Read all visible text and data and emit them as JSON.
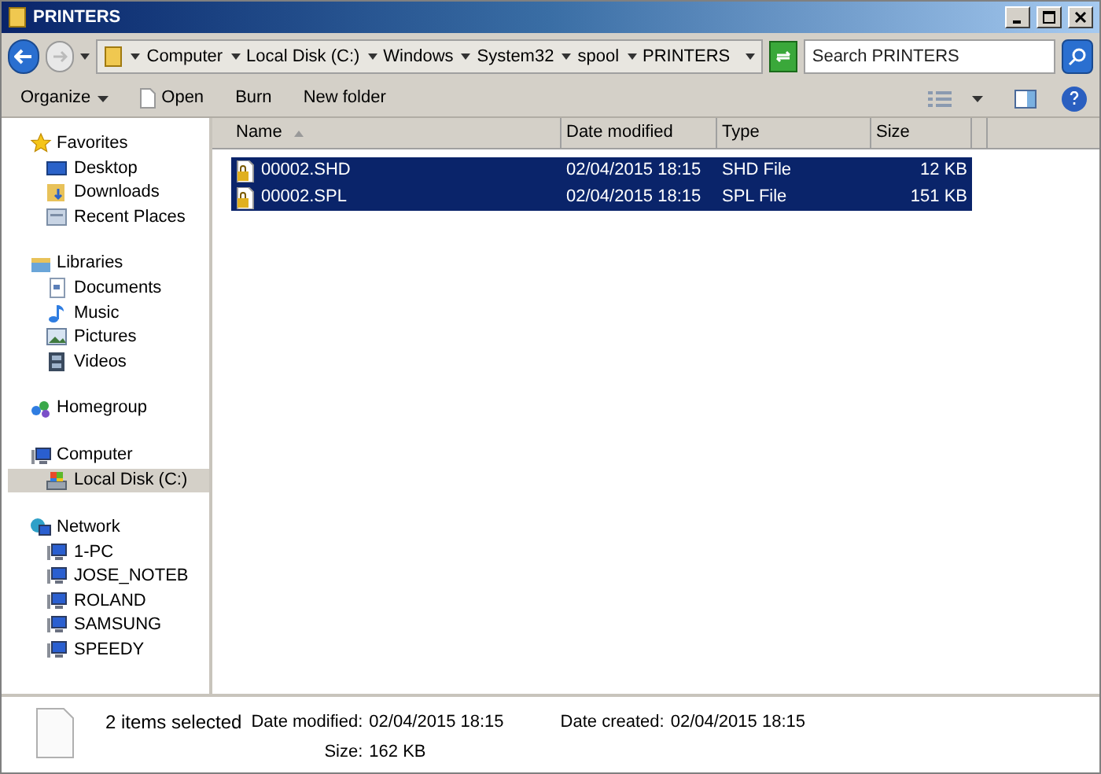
{
  "window": {
    "title": "PRINTERS"
  },
  "address": {
    "crumbs": [
      "Computer",
      "Local Disk (C:)",
      "Windows",
      "System32",
      "spool",
      "PRINTERS"
    ]
  },
  "search": {
    "placeholder": "Search PRINTERS"
  },
  "toolbar": [
    {
      "label": "Organize",
      "kind": "menu"
    },
    {
      "label": "Open",
      "kind": "icon"
    },
    {
      "label": "Burn",
      "kind": "plain"
    },
    {
      "label": "New folder",
      "kind": "plain"
    }
  ],
  "sidebar": {
    "groups": [
      {
        "label": "Favorites",
        "kind": "star",
        "selected": false,
        "children": [
          {
            "label": "Desktop",
            "kind": "desktop",
            "selected": false
          },
          {
            "label": "Downloads",
            "kind": "downloads",
            "selected": false
          },
          {
            "label": "Recent Places",
            "kind": "recent",
            "selected": false
          }
        ]
      },
      {
        "label": "Libraries",
        "kind": "library",
        "selected": false,
        "children": [
          {
            "label": "Documents",
            "kind": "document",
            "selected": false
          },
          {
            "label": "Music",
            "kind": "music",
            "selected": false
          },
          {
            "label": "Pictures",
            "kind": "pictures",
            "selected": false
          },
          {
            "label": "Videos",
            "kind": "videos",
            "selected": false
          }
        ]
      },
      {
        "label": "Homegroup",
        "kind": "homegroup",
        "selected": false
      },
      {
        "label": "Computer",
        "kind": "computer",
        "selected": false,
        "children": [
          {
            "label": "Local Disk (C:)",
            "kind": "disk",
            "selected": true
          }
        ]
      },
      {
        "label": "Network",
        "kind": "network",
        "selected": false,
        "children": [
          {
            "label": "1-PC",
            "kind": "computer",
            "selected": false
          },
          {
            "label": "JOSE_NOTEB",
            "kind": "computer",
            "selected": false
          },
          {
            "label": "ROLAND",
            "kind": "computer",
            "selected": false
          },
          {
            "label": "SAMSUNG",
            "kind": "computer",
            "selected": false
          },
          {
            "label": "SPEEDY",
            "kind": "computer",
            "selected": false
          }
        ]
      }
    ]
  },
  "table": {
    "columns": [
      {
        "label": "Name",
        "sorted": true
      },
      {
        "label": "Date modified",
        "sorted": false
      },
      {
        "label": "Type",
        "sorted": false
      },
      {
        "label": "Size",
        "sorted": false
      }
    ],
    "rows": [
      {
        "name": "00002.SHD",
        "date": "02/04/2015 18:15",
        "type": "SHD File",
        "size": "12 KB",
        "selected": true
      },
      {
        "name": "00002.SPL",
        "date": "02/04/2015 18:15",
        "type": "SPL File",
        "size": "151 KB",
        "selected": true
      }
    ]
  },
  "details": {
    "summary": "2 items selected",
    "fields": [
      {
        "label": "Date modified:",
        "value": "02/04/2015 18:15"
      },
      {
        "label": "Size:",
        "value": "162 KB"
      },
      {
        "label": "Date created:",
        "value": "02/04/2015 18:15"
      }
    ]
  }
}
